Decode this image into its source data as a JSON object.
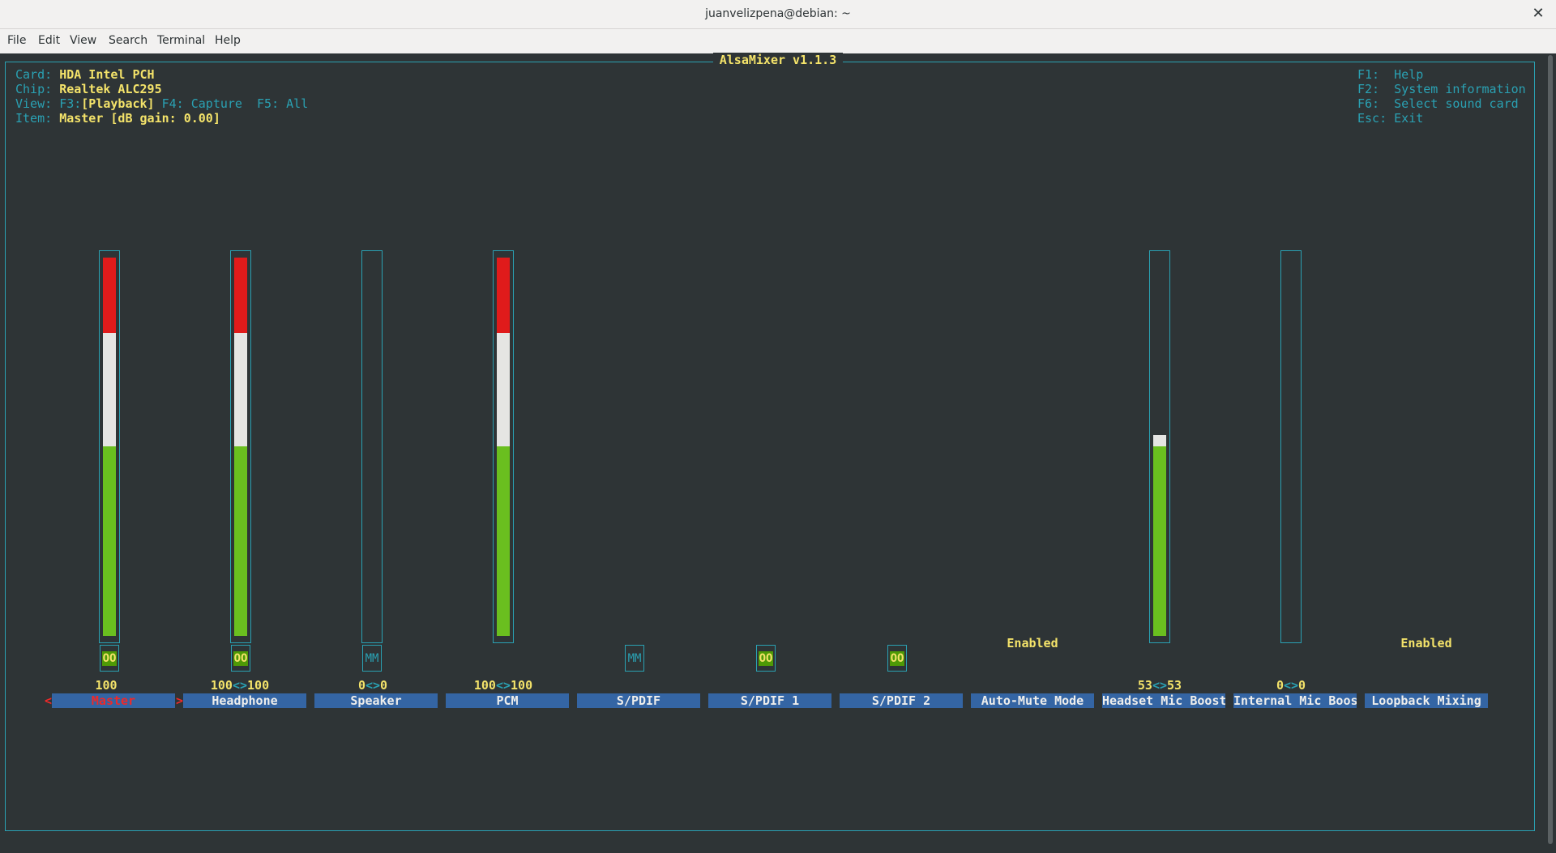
{
  "window": {
    "title": "juanvelizpena@debian: ~"
  },
  "menu": [
    "File",
    "Edit",
    "View",
    "Search",
    "Terminal",
    "Help"
  ],
  "app_name": "AlsaMixer v1.1.3",
  "info": {
    "card_label": "Card:",
    "card_value": "HDA Intel PCH",
    "chip_label": "Chip:",
    "chip_value": "Realtek ALC295",
    "view_label": "View:",
    "view_f3": "F3:",
    "view_playback": "[Playback]",
    "view_rest": " F4: Capture  F5: All",
    "item_label": "Item:",
    "item_value": "Master [dB gain: 0.00]"
  },
  "help": [
    "F1:  Help",
    "F2:  System information",
    "F6:  Select sound card",
    "Esc: Exit"
  ],
  "colors": {
    "background": "#2e3436",
    "cyan": "#2aa1b3",
    "yellow": "#f4e36a",
    "label_bg": "#3465a4",
    "red": "#ef2929",
    "green": "#4e9a06"
  },
  "controls": [
    {
      "name": "Master",
      "selected": true,
      "level": 100,
      "value_left": "100",
      "value_sep": "",
      "value_right": "",
      "switch": "OO",
      "switch_on": true
    },
    {
      "name": "Headphone",
      "level": 100,
      "value_left": "100",
      "value_sep": "<>",
      "value_right": "100",
      "switch": "OO",
      "switch_on": true
    },
    {
      "name": "Speaker",
      "level": 0,
      "value_left": "0",
      "value_sep": "<>",
      "value_right": "0",
      "switch": "MM",
      "switch_on": false
    },
    {
      "name": "PCM",
      "level": 100,
      "value_left": "100",
      "value_sep": "<>",
      "value_right": "100",
      "switch": "",
      "switch_on": null
    },
    {
      "name": "S/PDIF",
      "switch": "MM",
      "switch_on": false
    },
    {
      "name": "S/PDIF 1",
      "switch": "OO",
      "switch_on": true
    },
    {
      "name": "S/PDIF 2",
      "switch": "OO",
      "switch_on": true
    },
    {
      "name": "Auto-Mute Mode",
      "enum_value": "Enabled"
    },
    {
      "name": "Headset Mic Boost",
      "level": 53,
      "value_left": "53",
      "value_sep": "<>",
      "value_right": "53"
    },
    {
      "name": "Internal Mic Boos",
      "level": 0,
      "value_left": "0",
      "value_sep": "<>",
      "value_right": "0"
    },
    {
      "name": "Loopback Mixing",
      "enum_value": "Enabled"
    }
  ],
  "selection_markers": {
    "left": "<",
    "right": ">"
  }
}
